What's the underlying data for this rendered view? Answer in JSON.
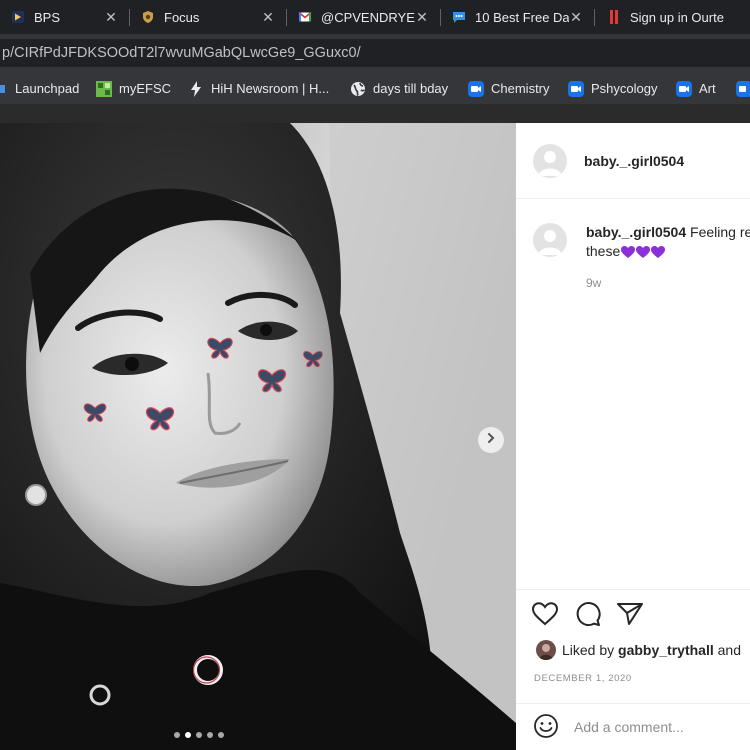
{
  "browser": {
    "tabs": [
      {
        "title": "BPS",
        "favicon": "bps-icon"
      },
      {
        "title": "Focus",
        "favicon": "focus-icon"
      },
      {
        "title": "@CPVENDRYE",
        "favicon": "gmail-icon"
      },
      {
        "title": "10 Best Free Da",
        "favicon": "chat-bubble-icon"
      },
      {
        "title": "Sign up in Ourte",
        "favicon": "pause-bars-icon"
      }
    ],
    "close_glyph": "✕",
    "url": "p/CIRfPdJFDKSOOdT2l7wvuMGabQLwcGe9_GGuxc0/",
    "bookmarks": [
      {
        "label": "Launchpad",
        "icon": "launchpad-icon"
      },
      {
        "label": "myEFSC",
        "icon": "efsc-icon"
      },
      {
        "label": "HiH Newsroom | H...",
        "icon": "bolt-icon"
      },
      {
        "label": "days till bday",
        "icon": "globe-icon"
      },
      {
        "label": "Chemistry",
        "icon": "meet-icon"
      },
      {
        "label": "Pshycology",
        "icon": "meet-icon"
      },
      {
        "label": "Art",
        "icon": "meet-icon"
      }
    ]
  },
  "post": {
    "author": "baby._.girl0504",
    "caption_text": "Feeling re",
    "caption_line2": "these",
    "caption_emoji": [
      "purple-heart",
      "purple-heart",
      "purple-heart"
    ],
    "time_ago": "9w",
    "liked_by_prefix": "Liked by",
    "liked_by_user": "gabby_trythall",
    "liked_by_suffix": "and",
    "date": "DECEMBER 1, 2020",
    "comment_placeholder": "Add a comment...",
    "carousel_count": 5,
    "carousel_active": 1
  },
  "colors": {
    "chrome_dark": "#202124",
    "toolbar": "#35363a",
    "purple_heart": "#8b2fd6",
    "link_text": "#262626",
    "muted_text": "#8e8e8e"
  }
}
